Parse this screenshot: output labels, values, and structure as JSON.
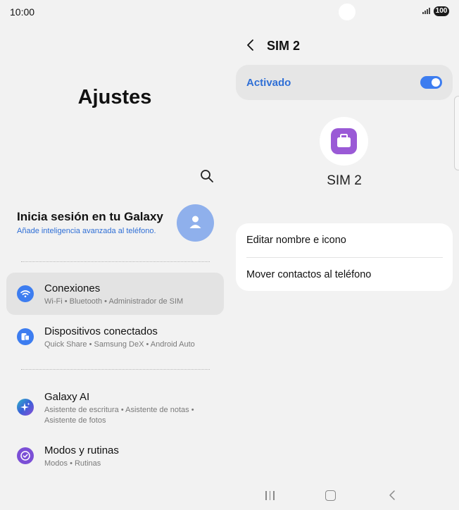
{
  "status_bar": {
    "time": "10:00",
    "battery": "100"
  },
  "left_pane": {
    "title": "Ajustes",
    "account": {
      "title": "Inicia sesión en tu Galaxy",
      "subtitle": "Añade inteligencia avanzada al teléfono."
    },
    "menu": [
      {
        "label": "Conexiones",
        "sub": "Wi-Fi • Bluetooth • Administrador de SIM",
        "icon": "wifi-icon",
        "color": "#3d7df0",
        "active": true
      },
      {
        "label": "Dispositivos conectados",
        "sub": "Quick Share • Samsung DeX • Android Auto",
        "icon": "connected-devices-icon",
        "color": "#3d7df0",
        "active": false
      },
      {
        "label": "Galaxy AI",
        "sub": "Asistente de escritura • Asistente de notas • Asistente de fotos",
        "icon": "galaxy-ai-icon",
        "color": "#3a78d8",
        "active": false
      },
      {
        "label": "Modos y rutinas",
        "sub": "Modos • Rutinas",
        "icon": "modes-routines-icon",
        "color": "#7b4fd6",
        "active": false
      }
    ]
  },
  "right_pane": {
    "header_title": "SIM 2",
    "activated_label": "Activado",
    "toggle_on": true,
    "sim_name": "SIM 2",
    "options": [
      "Editar nombre e icono",
      "Mover contactos al teléfono"
    ]
  },
  "colors": {
    "accent": "#3d7df0",
    "sim_icon": "#9a5ad6"
  }
}
